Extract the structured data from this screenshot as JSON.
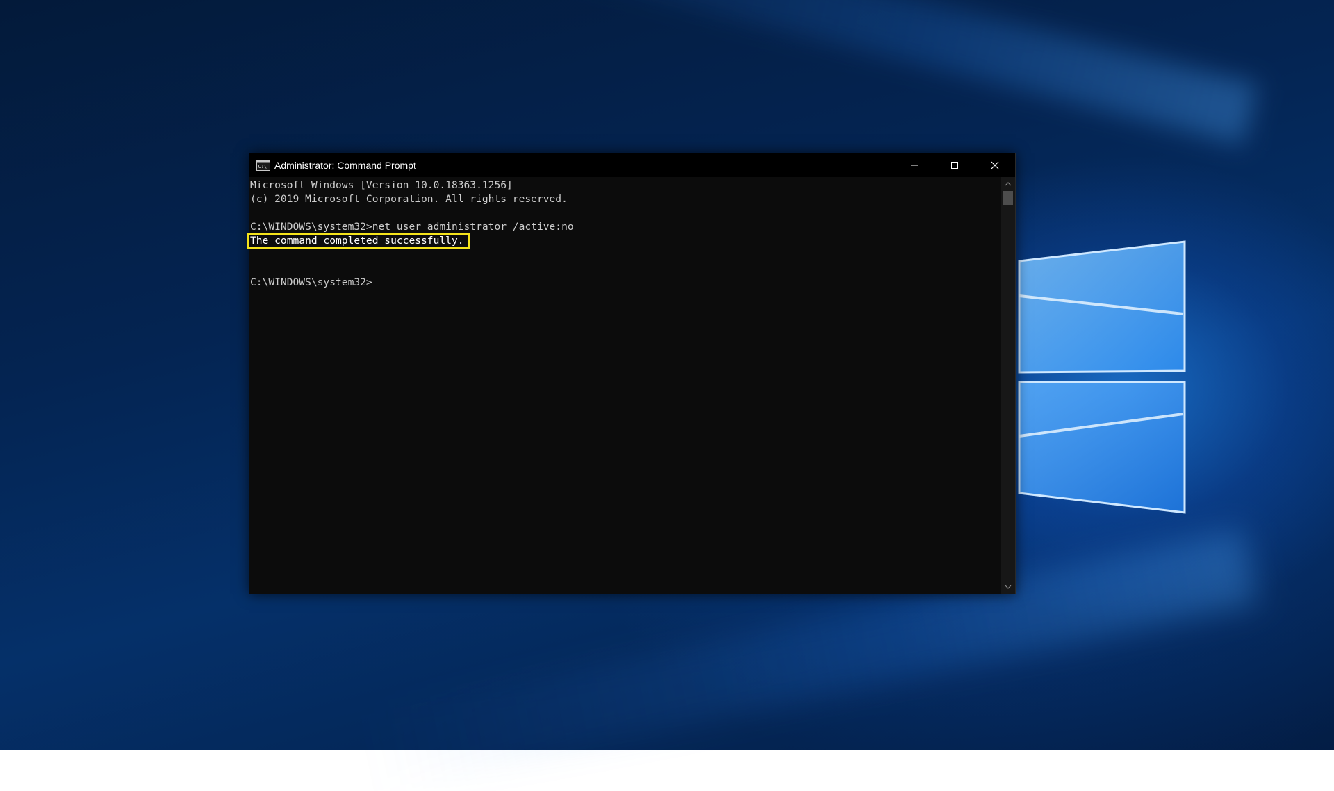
{
  "window": {
    "title": "Administrator: Command Prompt",
    "icon": "cmd-icon",
    "controls": {
      "minimize": "minimize-icon",
      "maximize": "maximize-icon",
      "close": "close-icon"
    }
  },
  "console": {
    "lines": [
      "Microsoft Windows [Version 10.0.18363.1256]",
      "(c) 2019 Microsoft Corporation. All rights reserved.",
      "C:\\WINDOWS\\system32>net user administrator /active:no",
      "The command completed successfully.",
      "C:\\WINDOWS\\system32>"
    ],
    "highlighted_line_index": 3
  },
  "colors": {
    "highlight": "#f4e31b",
    "console_background": "#0c0c0c",
    "console_text": "#cccccc",
    "desktop_accent": "#2a8cff"
  }
}
